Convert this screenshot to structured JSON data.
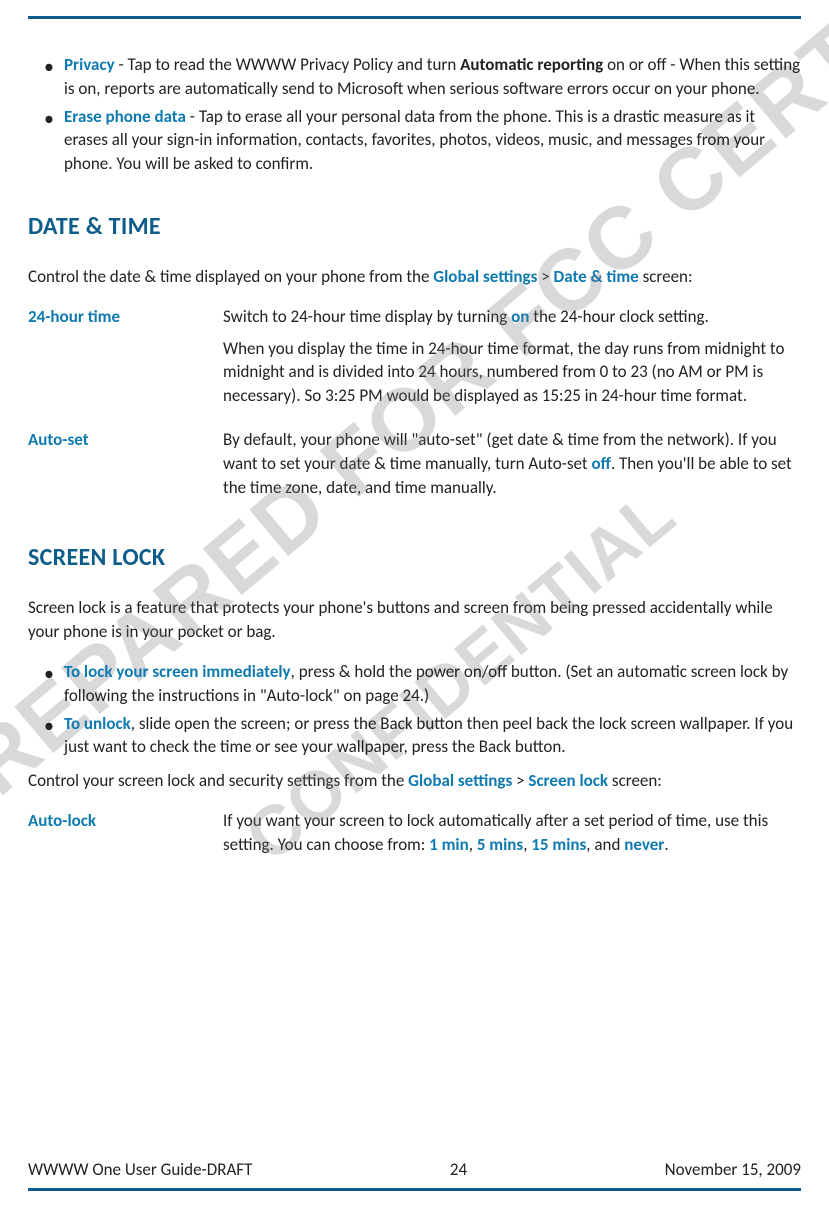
{
  "bullets_top": [
    {
      "lead": "Privacy",
      "text_before": " - Tap to read the WWWW Privacy Policy and turn ",
      "mid_bold": "Automatic reporting",
      "text_after": " on or off - When this setting is on, reports are automatically send to Microsoft when serious software errors occur on your phone."
    },
    {
      "lead": "Erase phone data",
      "text_before": " - Tap to erase all your personal data from the phone. This is a drastic measure as it erases all your sign-in information, contacts, favorites, photos, videos, music, and messages from your phone. You will be asked to confirm.",
      "mid_bold": "",
      "text_after": ""
    }
  ],
  "section1": {
    "heading": "DATE & TIME",
    "intro_parts": {
      "t1": "Control the date & time displayed on your phone from the ",
      "link1": "Global settings",
      "sep": " > ",
      "link2": "Date & time",
      "t2": " screen:"
    },
    "rows": [
      {
        "term": "24-hour time",
        "p1_a": "Switch to 24-hour time display by turning ",
        "p1_bold": "on",
        "p1_b": " the 24-hour clock setting.",
        "p2": "When you display the time in 24-hour time format, the day runs from midnight to midnight and is divided into 24 hours, numbered from 0 to 23 (no AM or PM is necessary). So 3:25 PM would be displayed as 15:25 in 24-hour time format."
      },
      {
        "term": "Auto-set",
        "p1_a": "By default, your phone will \"auto-set\" (get date & time from the network). If you want to set your date & time manually, turn Auto-set ",
        "p1_bold": "off",
        "p1_b": ". Then you'll be able to set the time zone, date, and time manually.",
        "p2": ""
      }
    ]
  },
  "section2": {
    "heading": "SCREEN LOCK",
    "intro": "Screen lock is a feature that protects your phone's buttons and screen from being pressed accidentally while your phone is in your pocket or bag.",
    "bullets": [
      {
        "lead": "To lock your screen immediately",
        "rest": ", press & hold the power on/off button. (Set an automatic screen lock by following the instructions in \"Auto-lock\" on page 24.)"
      },
      {
        "lead": "To unlock",
        "rest": ", slide open the screen; or press the Back button then peel back the lock screen wallpaper. If you just want to check the time or see your wallpaper, press the Back button."
      }
    ],
    "control_parts": {
      "t1": "Control your screen lock and security settings from the ",
      "link1": "Global settings",
      "sep": " > ",
      "link2": "Screen lock",
      "t2": " screen:"
    },
    "rows": [
      {
        "term": "Auto-lock",
        "p1_a": "If you want your screen to lock automatically after a set period of time, use this setting. You can choose from: ",
        "opts": [
          "1 min",
          "5 mins",
          "15 mins",
          "never"
        ],
        "comma": ", ",
        "and": ", and ",
        "period": "."
      }
    ]
  },
  "footer": {
    "left": "WWWW One User Guide-DRAFT",
    "center": "24",
    "right": "November 15, 2009"
  },
  "watermarks": {
    "wm1": "PREPARED FOR FCC CERTIFICATION",
    "wm2": "CONFIDENTIAL"
  }
}
